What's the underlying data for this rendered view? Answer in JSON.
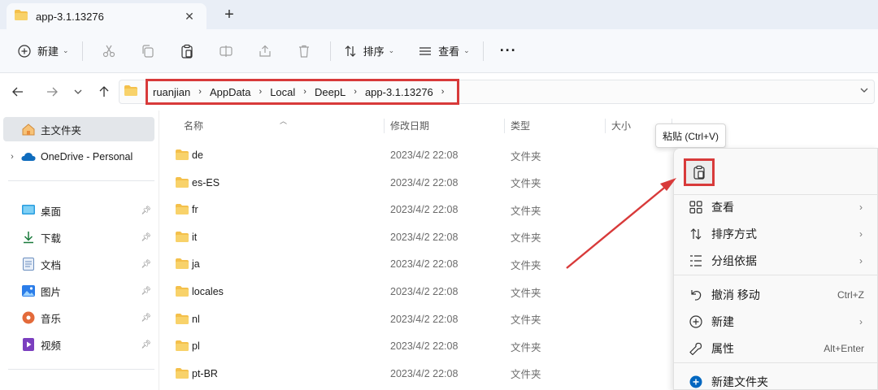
{
  "tab": {
    "title": "app-3.1.13276",
    "close_glyph": "✕",
    "new_tab_glyph": "+"
  },
  "toolbar": {
    "new_label": "新建",
    "sort_label": "排序",
    "view_label": "查看",
    "more_glyph": "···"
  },
  "address": {
    "breadcrumbs": [
      "ruanjian",
      "AppData",
      "Local",
      "DeepL",
      "app-3.1.13276"
    ]
  },
  "sidebar": {
    "home": "主文件夹",
    "onedrive": "OneDrive - Personal",
    "items": [
      {
        "label": "桌面",
        "icon": "desktop-icon"
      },
      {
        "label": "下载",
        "icon": "download-icon"
      },
      {
        "label": "文档",
        "icon": "document-icon"
      },
      {
        "label": "图片",
        "icon": "pictures-icon"
      },
      {
        "label": "音乐",
        "icon": "music-icon"
      },
      {
        "label": "视频",
        "icon": "video-icon"
      }
    ]
  },
  "columns": {
    "name": "名称",
    "date": "修改日期",
    "type": "类型",
    "size": "大小"
  },
  "files": [
    {
      "name": "de",
      "date": "2023/4/2 22:08",
      "type": "文件夹"
    },
    {
      "name": "es-ES",
      "date": "2023/4/2 22:08",
      "type": "文件夹"
    },
    {
      "name": "fr",
      "date": "2023/4/2 22:08",
      "type": "文件夹"
    },
    {
      "name": "it",
      "date": "2023/4/2 22:08",
      "type": "文件夹"
    },
    {
      "name": "ja",
      "date": "2023/4/2 22:08",
      "type": "文件夹"
    },
    {
      "name": "locales",
      "date": "2023/4/2 22:08",
      "type": "文件夹"
    },
    {
      "name": "nl",
      "date": "2023/4/2 22:08",
      "type": "文件夹"
    },
    {
      "name": "pl",
      "date": "2023/4/2 22:08",
      "type": "文件夹"
    },
    {
      "name": "pt-BR",
      "date": "2023/4/2 22:08",
      "type": "文件夹"
    }
  ],
  "context_menu": {
    "tooltip": "粘贴 (Ctrl+V)",
    "items": [
      {
        "label": "查看",
        "icon": "grid-view-icon",
        "shortcut": "",
        "has_submenu": true
      },
      {
        "label": "排序方式",
        "icon": "sort-icon",
        "shortcut": "",
        "has_submenu": true
      },
      {
        "label": "分组依据",
        "icon": "group-icon",
        "shortcut": "",
        "has_submenu": true
      },
      {
        "label": "撤消 移动",
        "icon": "undo-icon",
        "shortcut": "Ctrl+Z",
        "has_submenu": false
      },
      {
        "label": "新建",
        "icon": "add-circle-icon",
        "shortcut": "",
        "has_submenu": true
      },
      {
        "label": "属性",
        "icon": "wrench-icon",
        "shortcut": "Alt+Enter",
        "has_submenu": false
      },
      {
        "label": "新建文件夹",
        "icon": "new-folder-icon",
        "shortcut": "",
        "has_submenu": false
      }
    ]
  },
  "colors": {
    "annotation_red": "#d83a3a",
    "folder_yellow": "#f4c04b",
    "accent_blue": "#0067c0"
  }
}
